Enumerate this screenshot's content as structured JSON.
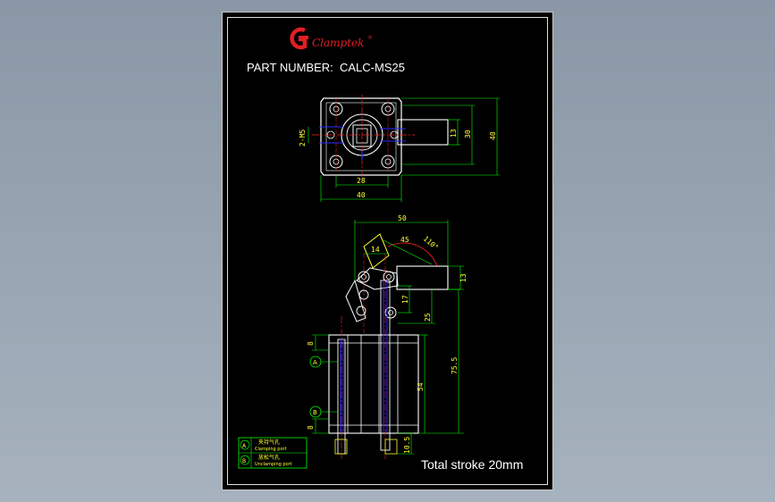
{
  "brand": {
    "name": "Clamptek",
    "registered_mark": "®",
    "logo_icon": "clamptek-logo-icon"
  },
  "title": {
    "label": "PART NUMBER:",
    "part_number": "CALC-MS25"
  },
  "top_view": {
    "dims": {
      "width_inner": "28",
      "width_outer": "40",
      "height_inner": "13",
      "height_mid": "30",
      "height_outer": "40",
      "port_thread": "2-M5"
    }
  },
  "side_view": {
    "dims": {
      "length_top": "50",
      "angle_45": "45",
      "angle_110": "110°",
      "offset_14": "14",
      "arm_13": "13",
      "pivot_17": "17",
      "pivot_25": "25",
      "height_75_5": "75.5",
      "body_54": "54",
      "gap_8_top": "8",
      "gap_8_bottom": "8",
      "rod_10_5": "10.5"
    },
    "port_markers": {
      "a": "A",
      "b": "B"
    }
  },
  "legend": {
    "rows": [
      {
        "marker": "A",
        "cn": "夹持气孔",
        "en": "Clamping port"
      },
      {
        "marker": "B",
        "cn": "放松气孔",
        "en": "Unclamping port"
      }
    ]
  },
  "footer": {
    "stroke": "Total stroke 20mm"
  },
  "colors": {
    "background": "#000000",
    "line_white": "#ffffff",
    "dimension": "#00ff00",
    "red": "#ff2020",
    "blue": "#2a2aff",
    "cyan": "#00e5ff",
    "yellow": "#ffff33",
    "brand_red": "#e31e24"
  }
}
